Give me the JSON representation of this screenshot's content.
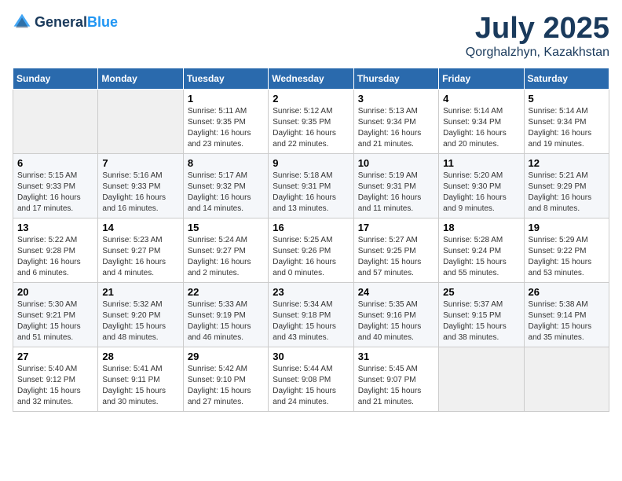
{
  "header": {
    "logo_general": "General",
    "logo_blue": "Blue",
    "month": "July 2025",
    "location": "Qorghalzhyn, Kazakhstan"
  },
  "days_of_week": [
    "Sunday",
    "Monday",
    "Tuesday",
    "Wednesday",
    "Thursday",
    "Friday",
    "Saturday"
  ],
  "weeks": [
    [
      {
        "day": "",
        "info": ""
      },
      {
        "day": "",
        "info": ""
      },
      {
        "day": "1",
        "info": "Sunrise: 5:11 AM\nSunset: 9:35 PM\nDaylight: 16 hours\nand 23 minutes."
      },
      {
        "day": "2",
        "info": "Sunrise: 5:12 AM\nSunset: 9:35 PM\nDaylight: 16 hours\nand 22 minutes."
      },
      {
        "day": "3",
        "info": "Sunrise: 5:13 AM\nSunset: 9:34 PM\nDaylight: 16 hours\nand 21 minutes."
      },
      {
        "day": "4",
        "info": "Sunrise: 5:14 AM\nSunset: 9:34 PM\nDaylight: 16 hours\nand 20 minutes."
      },
      {
        "day": "5",
        "info": "Sunrise: 5:14 AM\nSunset: 9:34 PM\nDaylight: 16 hours\nand 19 minutes."
      }
    ],
    [
      {
        "day": "6",
        "info": "Sunrise: 5:15 AM\nSunset: 9:33 PM\nDaylight: 16 hours\nand 17 minutes."
      },
      {
        "day": "7",
        "info": "Sunrise: 5:16 AM\nSunset: 9:33 PM\nDaylight: 16 hours\nand 16 minutes."
      },
      {
        "day": "8",
        "info": "Sunrise: 5:17 AM\nSunset: 9:32 PM\nDaylight: 16 hours\nand 14 minutes."
      },
      {
        "day": "9",
        "info": "Sunrise: 5:18 AM\nSunset: 9:31 PM\nDaylight: 16 hours\nand 13 minutes."
      },
      {
        "day": "10",
        "info": "Sunrise: 5:19 AM\nSunset: 9:31 PM\nDaylight: 16 hours\nand 11 minutes."
      },
      {
        "day": "11",
        "info": "Sunrise: 5:20 AM\nSunset: 9:30 PM\nDaylight: 16 hours\nand 9 minutes."
      },
      {
        "day": "12",
        "info": "Sunrise: 5:21 AM\nSunset: 9:29 PM\nDaylight: 16 hours\nand 8 minutes."
      }
    ],
    [
      {
        "day": "13",
        "info": "Sunrise: 5:22 AM\nSunset: 9:28 PM\nDaylight: 16 hours\nand 6 minutes."
      },
      {
        "day": "14",
        "info": "Sunrise: 5:23 AM\nSunset: 9:27 PM\nDaylight: 16 hours\nand 4 minutes."
      },
      {
        "day": "15",
        "info": "Sunrise: 5:24 AM\nSunset: 9:27 PM\nDaylight: 16 hours\nand 2 minutes."
      },
      {
        "day": "16",
        "info": "Sunrise: 5:25 AM\nSunset: 9:26 PM\nDaylight: 16 hours\nand 0 minutes."
      },
      {
        "day": "17",
        "info": "Sunrise: 5:27 AM\nSunset: 9:25 PM\nDaylight: 15 hours\nand 57 minutes."
      },
      {
        "day": "18",
        "info": "Sunrise: 5:28 AM\nSunset: 9:24 PM\nDaylight: 15 hours\nand 55 minutes."
      },
      {
        "day": "19",
        "info": "Sunrise: 5:29 AM\nSunset: 9:22 PM\nDaylight: 15 hours\nand 53 minutes."
      }
    ],
    [
      {
        "day": "20",
        "info": "Sunrise: 5:30 AM\nSunset: 9:21 PM\nDaylight: 15 hours\nand 51 minutes."
      },
      {
        "day": "21",
        "info": "Sunrise: 5:32 AM\nSunset: 9:20 PM\nDaylight: 15 hours\nand 48 minutes."
      },
      {
        "day": "22",
        "info": "Sunrise: 5:33 AM\nSunset: 9:19 PM\nDaylight: 15 hours\nand 46 minutes."
      },
      {
        "day": "23",
        "info": "Sunrise: 5:34 AM\nSunset: 9:18 PM\nDaylight: 15 hours\nand 43 minutes."
      },
      {
        "day": "24",
        "info": "Sunrise: 5:35 AM\nSunset: 9:16 PM\nDaylight: 15 hours\nand 40 minutes."
      },
      {
        "day": "25",
        "info": "Sunrise: 5:37 AM\nSunset: 9:15 PM\nDaylight: 15 hours\nand 38 minutes."
      },
      {
        "day": "26",
        "info": "Sunrise: 5:38 AM\nSunset: 9:14 PM\nDaylight: 15 hours\nand 35 minutes."
      }
    ],
    [
      {
        "day": "27",
        "info": "Sunrise: 5:40 AM\nSunset: 9:12 PM\nDaylight: 15 hours\nand 32 minutes."
      },
      {
        "day": "28",
        "info": "Sunrise: 5:41 AM\nSunset: 9:11 PM\nDaylight: 15 hours\nand 30 minutes."
      },
      {
        "day": "29",
        "info": "Sunrise: 5:42 AM\nSunset: 9:10 PM\nDaylight: 15 hours\nand 27 minutes."
      },
      {
        "day": "30",
        "info": "Sunrise: 5:44 AM\nSunset: 9:08 PM\nDaylight: 15 hours\nand 24 minutes."
      },
      {
        "day": "31",
        "info": "Sunrise: 5:45 AM\nSunset: 9:07 PM\nDaylight: 15 hours\nand 21 minutes."
      },
      {
        "day": "",
        "info": ""
      },
      {
        "day": "",
        "info": ""
      }
    ]
  ]
}
